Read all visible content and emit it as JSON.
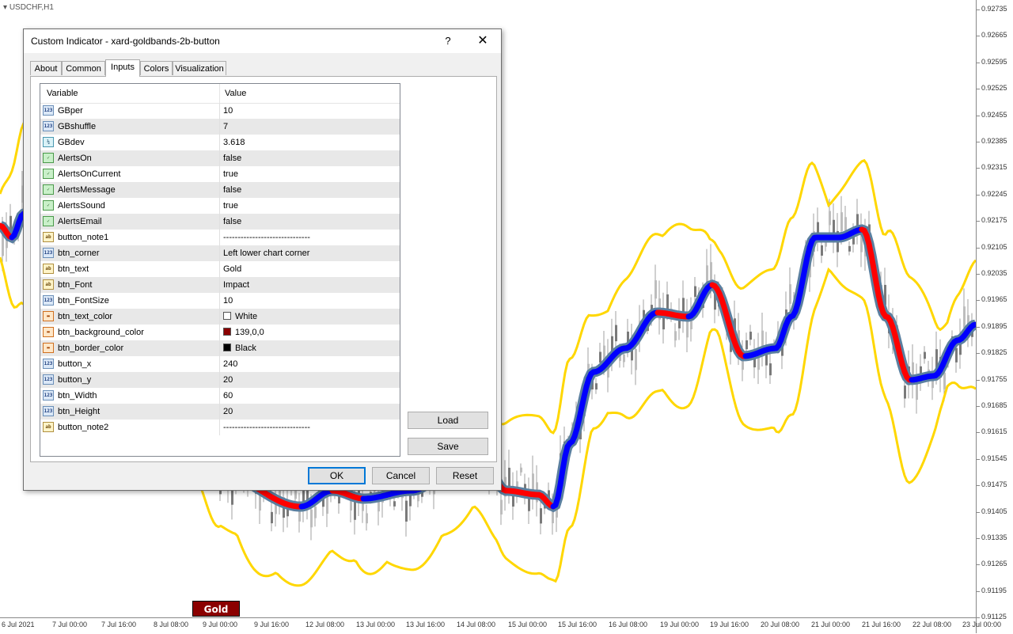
{
  "chart": {
    "symbol": "USDCHF,H1",
    "price_ticks": [
      "0.92735",
      "0.92665",
      "0.92595",
      "0.92525",
      "0.92455",
      "0.92385",
      "0.92315",
      "0.92245",
      "0.92175",
      "0.92105",
      "0.92035",
      "0.91965",
      "0.91895",
      "0.91825",
      "0.91755",
      "0.91685",
      "0.91615",
      "0.91545",
      "0.91475",
      "0.91405",
      "0.91335",
      "0.91265",
      "0.91195",
      "0.91125"
    ],
    "time_ticks": [
      "6 Jul 2021",
      "7 Jul 00:00",
      "7 Jul 16:00",
      "8 Jul 08:00",
      "9 Jul 00:00",
      "9 Jul 16:00",
      "12 Jul 08:00",
      "13 Jul 00:00",
      "13 Jul 16:00",
      "14 Jul 08:00",
      "15 Jul 00:00",
      "15 Jul 16:00",
      "16 Jul 08:00",
      "19 Jul 00:00",
      "19 Jul 16:00",
      "20 Jul 08:00",
      "21 Jul 00:00",
      "21 Jul 16:00",
      "22 Jul 08:00",
      "23 Jul 00:00"
    ],
    "colors": {
      "band": "#ffd700",
      "trend_up": "#0000ff",
      "trend_down": "#ff0000",
      "trend_border": "#5a7fa0",
      "candle": "#a0a0a0"
    },
    "chart_button": {
      "label": "Gold",
      "text_color": "#ffffff",
      "background": "#8b0000",
      "border": "#000000"
    }
  },
  "dialog": {
    "title": "Custom Indicator - xard-goldbands-2b-button",
    "help": "?",
    "close": "✕",
    "tabs": [
      "About",
      "Common",
      "Inputs",
      "Colors",
      "Visualization"
    ],
    "active_tab": "Inputs",
    "columns": {
      "variable": "Variable",
      "value": "Value"
    },
    "rows": [
      {
        "icon": "int",
        "icon_text": "123",
        "var": "GBper",
        "val": "10"
      },
      {
        "icon": "int",
        "icon_text": "123",
        "var": "GBshuffle",
        "val": "7"
      },
      {
        "icon": "dbl",
        "icon_text": "½",
        "var": "GBdev",
        "val": "3.618"
      },
      {
        "icon": "bool",
        "icon_text": "✓",
        "var": "AlertsOn",
        "val": "false"
      },
      {
        "icon": "bool",
        "icon_text": "✓",
        "var": "AlertsOnCurrent",
        "val": "true"
      },
      {
        "icon": "bool",
        "icon_text": "✓",
        "var": "AlertsMessage",
        "val": "false"
      },
      {
        "icon": "bool",
        "icon_text": "✓",
        "var": "AlertsSound",
        "val": "true"
      },
      {
        "icon": "bool",
        "icon_text": "✓",
        "var": "AlertsEmail",
        "val": "false"
      },
      {
        "icon": "str",
        "icon_text": "ab",
        "var": "button_note1",
        "val": "------------------------------"
      },
      {
        "icon": "int",
        "icon_text": "123",
        "var": "btn_corner",
        "val": "Left lower chart corner"
      },
      {
        "icon": "str",
        "icon_text": "ab",
        "var": "btn_text",
        "val": "Gold"
      },
      {
        "icon": "str",
        "icon_text": "ab",
        "var": "btn_Font",
        "val": "Impact"
      },
      {
        "icon": "int",
        "icon_text": "123",
        "var": "btn_FontSize",
        "val": "10"
      },
      {
        "icon": "color",
        "icon_text": "▬",
        "var": "btn_text_color",
        "val": "White",
        "swatch": "#ffffff"
      },
      {
        "icon": "color",
        "icon_text": "▬",
        "var": "btn_background_color",
        "val": "139,0,0",
        "swatch": "#8b0000"
      },
      {
        "icon": "color",
        "icon_text": "▬",
        "var": "btn_border_color",
        "val": "Black",
        "swatch": "#000000"
      },
      {
        "icon": "int",
        "icon_text": "123",
        "var": "button_x",
        "val": "240"
      },
      {
        "icon": "int",
        "icon_text": "123",
        "var": "button_y",
        "val": "20"
      },
      {
        "icon": "int",
        "icon_text": "123",
        "var": "btn_Width",
        "val": "60"
      },
      {
        "icon": "int",
        "icon_text": "123",
        "var": "btn_Height",
        "val": "20"
      },
      {
        "icon": "str",
        "icon_text": "ab",
        "var": "button_note2",
        "val": "------------------------------"
      }
    ],
    "buttons": {
      "load": "Load",
      "save": "Save",
      "ok": "OK",
      "cancel": "Cancel",
      "reset": "Reset"
    }
  }
}
